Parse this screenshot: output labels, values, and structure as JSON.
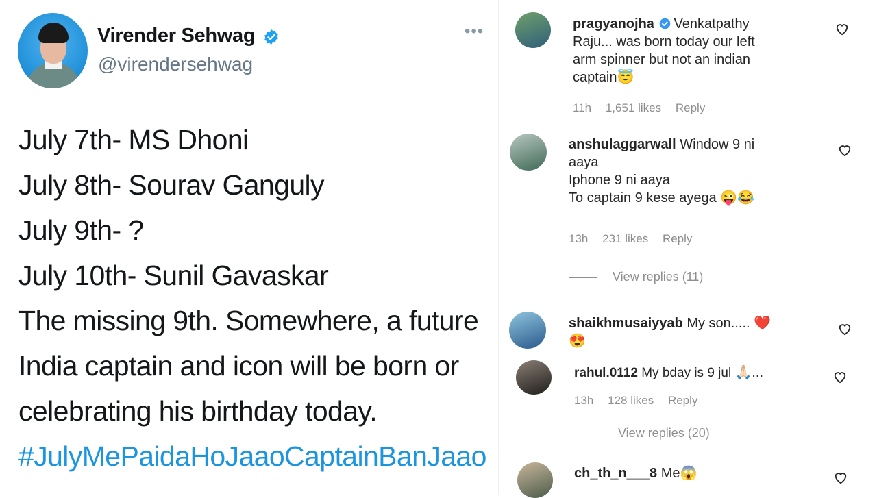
{
  "tweet": {
    "name": "Virender Sehwag",
    "handle": "@virendersehwag",
    "more_label": "•••",
    "lines": [
      "July 7th- MS Dhoni",
      "July 8th- Sourav Ganguly",
      "July 9th- ?",
      "July 10th- Sunil Gavaskar",
      "The missing 9th. Somewhere, a future",
      "India captain and icon will be born or",
      "celebrating his birthday today."
    ],
    "hashtag": "#JulyMePaidaHoJaaoCaptainBanJaao"
  },
  "comments": [
    {
      "username": "pragyanojha",
      "verified": true,
      "text_lines": [
        "Venkatpathy",
        "Raju... was born today our left",
        "arm spinner but not an indian",
        "captain"
      ],
      "emoji": "😇",
      "time": "11h",
      "likes": "1,651 likes",
      "reply": "Reply"
    },
    {
      "username": "anshulaggarwall",
      "text_lines": [
        "Window 9 ni",
        "aaya",
        "Iphone 9 ni aaya",
        "To captain 9 kese ayega"
      ],
      "emoji": "😜😂",
      "time": "13h",
      "likes": "231 likes",
      "reply": "Reply",
      "view_replies": "View replies (11)"
    },
    {
      "username": "shaikhmusaiyyab",
      "text_lines": [
        "My son....."
      ],
      "emoji": "❤️",
      "emoji2": "😍"
    },
    {
      "username": "rahul.0112",
      "text_lines": [
        "My bday is 9 jul"
      ],
      "emoji": "🙏🏻...",
      "time": "13h",
      "likes": "128 likes",
      "reply": "Reply",
      "view_replies": "View replies (20)"
    },
    {
      "username": "ch_th_n___8",
      "text_lines": [
        "Me"
      ],
      "emoji": "😱"
    }
  ],
  "icons": {
    "verified": "verified-badge-icon",
    "heart": "heart-outline-icon",
    "more": "more-horizontal-icon"
  },
  "colors": {
    "hashtag": "#1b95e0",
    "verified": "#1da1f2",
    "meta": "#8e8e8e"
  }
}
